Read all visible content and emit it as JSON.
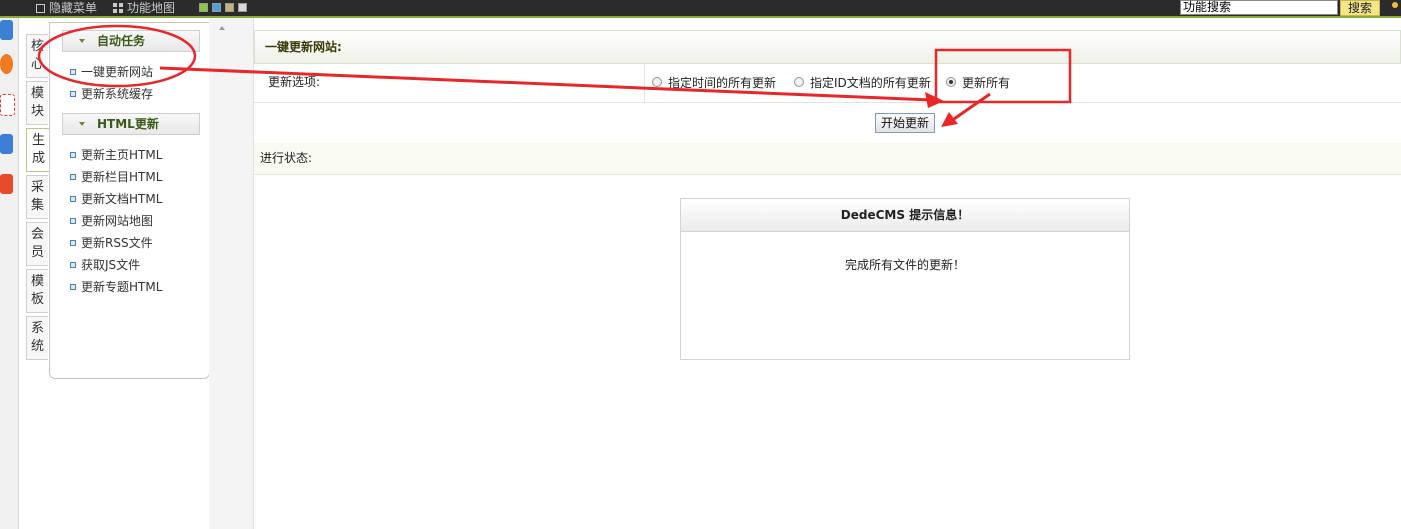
{
  "topbar": {
    "hide_menu_label": "隐藏菜单",
    "function_map_label": "功能地图",
    "theme_swatches": [
      "#8dc63f",
      "#4aa3df",
      "#c8b27a",
      "#d8d8d8"
    ],
    "search_value": "功能搜索",
    "search_button": "搜索"
  },
  "vtabs": [
    {
      "line1": "核",
      "line2": "心"
    },
    {
      "line1": "模",
      "line2": "块"
    },
    {
      "line1": "生",
      "line2": "成"
    },
    {
      "line1": "采",
      "line2": "集"
    },
    {
      "line1": "会",
      "line2": "员"
    },
    {
      "line1": "模",
      "line2": "板"
    },
    {
      "line1": "系",
      "line2": "统"
    }
  ],
  "menu": {
    "group1_title": "自动任务",
    "group1_items": [
      "一键更新网站",
      "更新系统缓存"
    ],
    "group2_title": "HTML更新",
    "group2_items": [
      "更新主页HTML",
      "更新栏目HTML",
      "更新文档HTML",
      "更新网站地图",
      "更新RSS文件",
      "获取JS文件",
      "更新专题HTML"
    ]
  },
  "main": {
    "title": "一键更新网站:",
    "option_label": "更新选项:",
    "radios": [
      {
        "label": "指定时间的所有更新",
        "checked": false
      },
      {
        "label": "指定ID文档的所有更新",
        "checked": false
      },
      {
        "label": "更新所有",
        "checked": true
      }
    ],
    "start_button": "开始更新",
    "status_label": "进行状态:"
  },
  "message": {
    "title": "DedeCMS 提示信息！",
    "body": "完成所有文件的更新！"
  },
  "colors": {
    "accent_green": "#8aa83c",
    "annotation_red": "#e8272a",
    "search_button_bg": "#f1e68a"
  }
}
